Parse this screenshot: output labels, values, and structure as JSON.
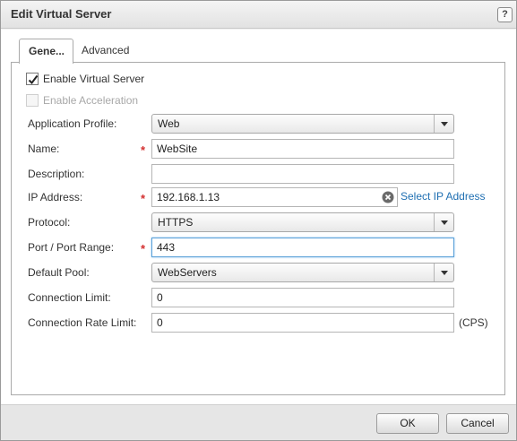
{
  "dialog": {
    "title": "Edit Virtual Server",
    "help_label": "?"
  },
  "tabs": [
    {
      "label": "Gene...",
      "active": true
    },
    {
      "label": "Advanced",
      "active": false
    }
  ],
  "general": {
    "enable_virtual_server": {
      "label": "Enable Virtual Server",
      "checked": true
    },
    "enable_acceleration": {
      "label": "Enable Acceleration",
      "checked": false,
      "disabled": true
    },
    "fields": {
      "application_profile": {
        "label": "Application Profile:",
        "value": "Web"
      },
      "name": {
        "label": "Name:",
        "value": "WebSite",
        "required_mark": "*"
      },
      "description": {
        "label": "Description:",
        "value": ""
      },
      "ip_address": {
        "label": "IP Address:",
        "value": "192.168.1.13",
        "required_mark": "*",
        "link": "Select IP Address"
      },
      "protocol": {
        "label": "Protocol:",
        "value": "HTTPS"
      },
      "port": {
        "label": "Port / Port Range:",
        "value": "443",
        "required_mark": "*"
      },
      "default_pool": {
        "label": "Default Pool:",
        "value": "WebServers"
      },
      "connection_limit": {
        "label": "Connection Limit:",
        "value": "0"
      },
      "connection_rate_limit": {
        "label": "Connection Rate Limit:",
        "value": "0",
        "suffix": "(CPS)"
      }
    }
  },
  "footer": {
    "ok_label": "OK",
    "cancel_label": "Cancel"
  },
  "colors": {
    "required": "#d32f2f",
    "link": "#1f6fb2",
    "focus_border": "#5aa0d8"
  }
}
